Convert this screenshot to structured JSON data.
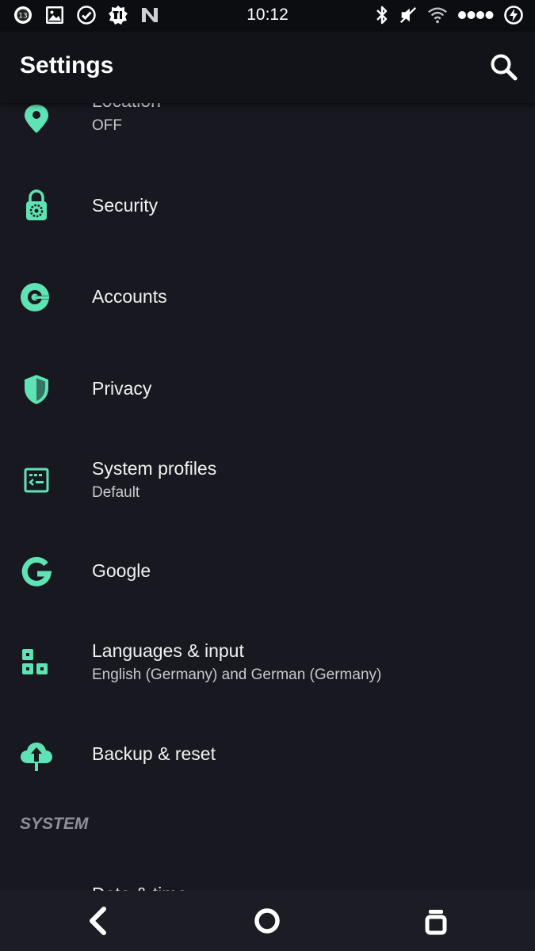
{
  "status_bar": {
    "time": "10:12",
    "notification_badge": "13",
    "left_icons": [
      "notification-count-icon",
      "image-icon",
      "check-circle-icon",
      "app-icon",
      "n-logo-icon"
    ],
    "right_icons": [
      "bluetooth-icon",
      "vibrate-off-icon",
      "wifi-icon",
      "signal-dots-icon",
      "battery-charging-icon"
    ]
  },
  "toolbar": {
    "title": "Settings",
    "search_icon": "search-icon"
  },
  "items": [
    {
      "label": "Location",
      "sub": "OFF",
      "icon": "location-pin-icon"
    },
    {
      "label": "Security",
      "sub": "",
      "icon": "lock-icon"
    },
    {
      "label": "Accounts",
      "sub": "",
      "icon": "account-key-icon"
    },
    {
      "label": "Privacy",
      "sub": "",
      "icon": "shield-icon"
    },
    {
      "label": "System profiles",
      "sub": "Default",
      "icon": "profile-icon"
    },
    {
      "label": "Google",
      "sub": "",
      "icon": "google-icon"
    },
    {
      "label": "Languages & input",
      "sub": "English (Germany) and German (Germany)",
      "icon": "languages-icon"
    },
    {
      "label": "Backup & reset",
      "sub": "",
      "icon": "cloud-upload-icon"
    }
  ],
  "section_system": "SYSTEM",
  "partial_item": {
    "label": "Date & time",
    "icon": "clock-icon"
  },
  "nav_bar": {
    "back_icon": "back-icon",
    "home_icon": "home-icon",
    "recents_icon": "recents-icon"
  },
  "colors": {
    "background": "#181920",
    "accent": "#5fe3b4",
    "toolbar": "#121318",
    "status_bar": "#0c0d11",
    "text_secondary": "#c8c9cc",
    "section_header": "#8e9098"
  }
}
